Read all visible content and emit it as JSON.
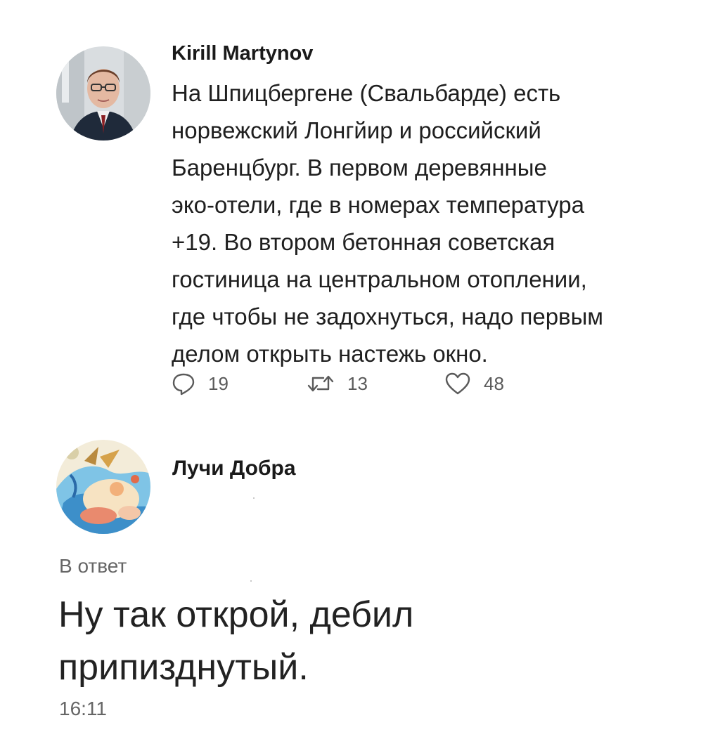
{
  "tweet": {
    "author": "Kirill Martynov",
    "avatar_icon": "person-photo",
    "lines": [
      "На Шпицбергене (Свальбарде) есть",
      "норвежский Лонгйир и российский",
      "Баренцбург. В первом деревянные",
      "эко-отели, где в номерах температура",
      "+19. Во втором бетонная советская",
      "гостиница на центральном отоплении,",
      "где чтобы не задохнуться, надо первым",
      "делом открыть настежь окно."
    ],
    "actions": {
      "reply": {
        "icon": "speech-bubble-icon",
        "count": "19"
      },
      "retweet": {
        "icon": "retweet-icon",
        "count": "13"
      },
      "like": {
        "icon": "heart-icon",
        "count": "48"
      }
    }
  },
  "reply": {
    "author": "Лучи Добра",
    "avatar_icon": "cartoon-illustration",
    "label": "В ответ",
    "lines": [
      "Ну так открой, дебил",
      "припизднутый."
    ],
    "time": "16:11"
  },
  "colors": {
    "text": "#1a1a1a",
    "muted": "#5a5a5a",
    "background": "#ffffff"
  }
}
